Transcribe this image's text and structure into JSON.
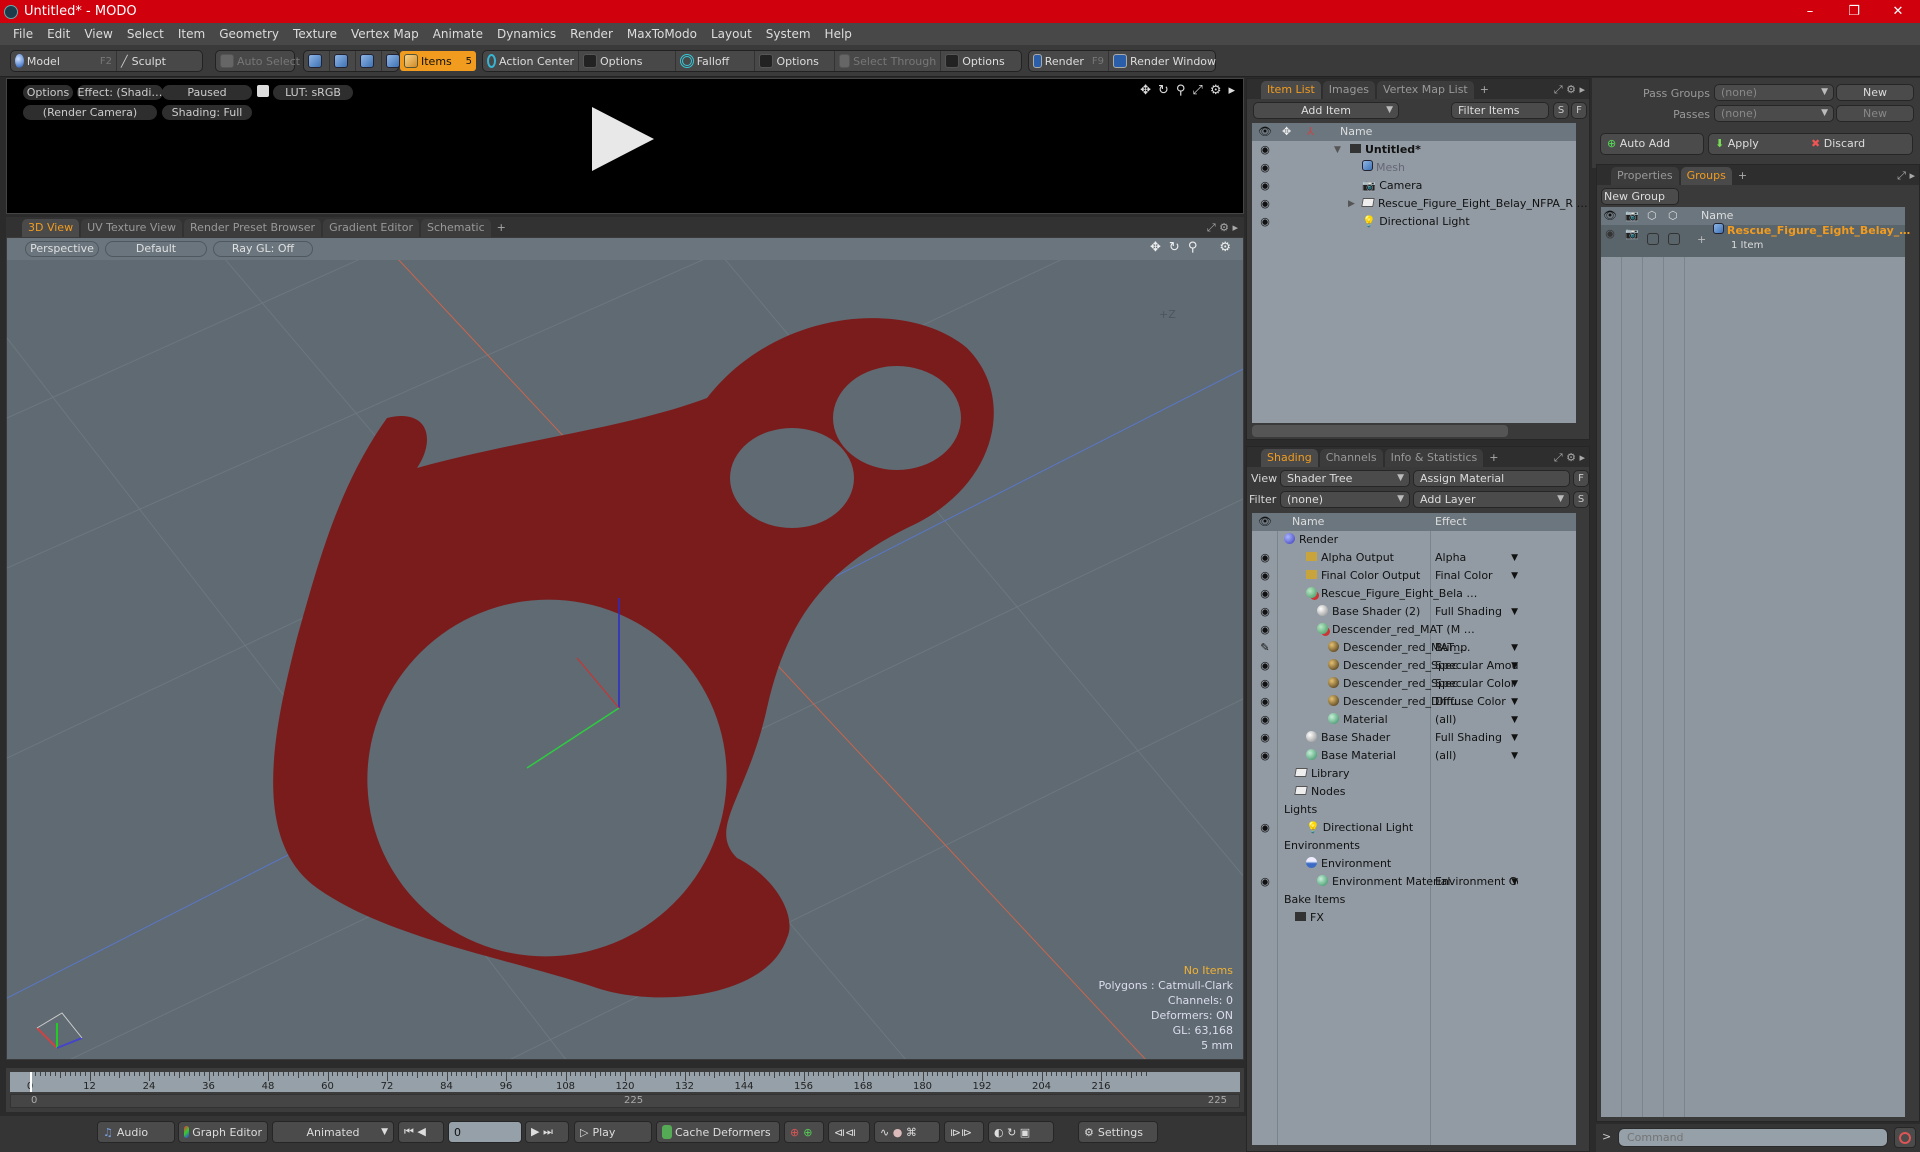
{
  "window": {
    "title": "Untitled* - MODO",
    "controls": [
      "–",
      "❐",
      "✕"
    ]
  },
  "menu": [
    "File",
    "Edit",
    "View",
    "Select",
    "Item",
    "Geometry",
    "Texture",
    "Vertex Map",
    "Animate",
    "Dynamics",
    "Render",
    "MaxToModo",
    "Layout",
    "System",
    "Help"
  ],
  "toolbar": {
    "model": "Model",
    "model_key": "F2",
    "sculpt": "Sculpt",
    "auto_select": "Auto Select",
    "items": "Items",
    "items_key": "5",
    "action_center": "Action Center",
    "options1": "Options",
    "falloff": "Falloff",
    "options2": "Options",
    "select_through": "Select Through",
    "options3": "Options",
    "render": "Render",
    "render_key": "F9",
    "render_window": "Render Window"
  },
  "preview": {
    "options": "Options",
    "effect": "Effect: (Shadi…",
    "paused": "Paused",
    "lut": "LUT: sRGB",
    "camera": "(Render Camera)",
    "shading": "Shading: Full"
  },
  "viewport_tabs": [
    "3D View",
    "UV Texture View",
    "Render Preset Browser",
    "Gradient Editor",
    "Schematic"
  ],
  "viewport": {
    "perspective": "Perspective",
    "style": "Default",
    "raygl": "Ray GL: Off",
    "axis_label": "+Z",
    "info": {
      "items": "No Items",
      "polygons": "Polygons : Catmull-Clark",
      "channels": "Channels: 0",
      "deformers": "Deformers: ON",
      "gl": "GL: 63,168",
      "unit": "5 mm"
    },
    "model_color": "#7a1c1c"
  },
  "timeline": {
    "ticks": [
      "0",
      "12",
      "24",
      "36",
      "48",
      "60",
      "72",
      "84",
      "96",
      "108",
      "120",
      "132",
      "144",
      "156",
      "168",
      "180",
      "192",
      "204",
      "216"
    ],
    "range_start": "0",
    "range_mid": "225",
    "range_end": "225"
  },
  "transport": {
    "audio": "Audio",
    "graph_editor": "Graph Editor",
    "animated": "Animated",
    "frame": "0",
    "play": "Play",
    "cache_deformers": "Cache Deformers",
    "settings": "Settings"
  },
  "item_list": {
    "tabs": [
      "Item List",
      "Images",
      "Vertex Map List"
    ],
    "add_item": "Add Item",
    "filter": "Filter Items",
    "s": "S",
    "f": "F",
    "header_name": "Name",
    "rows": [
      {
        "name": "Untitled*",
        "type": "scene"
      },
      {
        "name": "Mesh",
        "type": "mesh"
      },
      {
        "name": "Camera",
        "type": "camera"
      },
      {
        "name": "Rescue_Figure_Eight_Belay_NFPA_R …",
        "type": "group"
      },
      {
        "name": "Directional Light",
        "type": "light"
      }
    ]
  },
  "shading": {
    "tabs": [
      "Shading",
      "Channels",
      "Info & Statistics"
    ],
    "view_label": "View",
    "view_value": "Shader Tree",
    "assign_material": "Assign Material",
    "f": "F",
    "filter_label": "Filter",
    "filter_value": "(none)",
    "add_layer": "Add Layer",
    "s": "S",
    "header_name": "Name",
    "header_effect": "Effect",
    "rows": [
      {
        "name": "Render",
        "effect": "",
        "indent": 0
      },
      {
        "name": "Alpha Output",
        "effect": "Alpha",
        "indent": 2
      },
      {
        "name": "Final Color Output",
        "effect": "Final Color",
        "indent": 2
      },
      {
        "name": "Rescue_Figure_Eight_Bela …",
        "effect": "",
        "indent": 2
      },
      {
        "name": "Base Shader (2)",
        "effect": "Full Shading",
        "indent": 3
      },
      {
        "name": "Descender_red_MAT (M …",
        "effect": "",
        "indent": 3
      },
      {
        "name": "Descender_red_MAT_…",
        "effect": "Bump",
        "indent": 4
      },
      {
        "name": "Descender_red_Spec …",
        "effect": "Specular Amount",
        "indent": 4
      },
      {
        "name": "Descender_red_Spec …",
        "effect": "Specular Color",
        "indent": 4
      },
      {
        "name": "Descender_red_Diffu …",
        "effect": "Diffuse Color",
        "indent": 4
      },
      {
        "name": "Material",
        "effect": "(all)",
        "indent": 4
      },
      {
        "name": "Base Shader",
        "effect": "Full Shading",
        "indent": 2
      },
      {
        "name": "Base Material",
        "effect": "(all)",
        "indent": 2
      },
      {
        "name": "Library",
        "effect": "",
        "indent": 1
      },
      {
        "name": "Nodes",
        "effect": "",
        "indent": 1
      },
      {
        "name": "Lights",
        "effect": "",
        "indent": 0
      },
      {
        "name": "Directional Light",
        "effect": "",
        "indent": 2
      },
      {
        "name": "Environments",
        "effect": "",
        "indent": 0
      },
      {
        "name": "Environment",
        "effect": "",
        "indent": 2
      },
      {
        "name": "Environment Material",
        "effect": "Environment Color",
        "indent": 3
      },
      {
        "name": "Bake Items",
        "effect": "",
        "indent": 0
      },
      {
        "name": "FX",
        "effect": "",
        "indent": 1
      }
    ]
  },
  "groups_panel": {
    "pass_groups_label": "Pass Groups",
    "pass_groups_value": "(none)",
    "new1": "New",
    "passes_label": "Passes",
    "passes_value": "(none)",
    "new2": "New",
    "auto_add": "Auto Add",
    "apply": "Apply",
    "discard": "Discard",
    "tabs": [
      "Properties",
      "Groups"
    ],
    "new_group": "New Group",
    "header_name": "Name",
    "group_name": "Rescue_Figure_Eight_Belay_…",
    "group_count": "1 Item"
  },
  "command": {
    "prompt": ">",
    "placeholder": "Command"
  }
}
